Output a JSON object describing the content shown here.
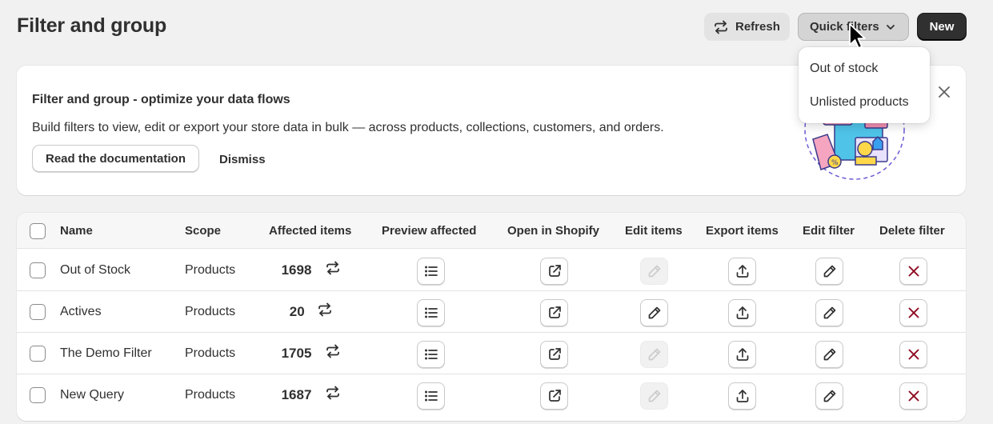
{
  "header": {
    "title": "Filter and group",
    "refresh_label": "Refresh",
    "quick_filters_label": "Quick filters",
    "new_label": "New"
  },
  "quick_filters_menu": {
    "items": [
      "Out of stock",
      "Unlisted products"
    ]
  },
  "banner": {
    "title": "Filter and group - optimize your data flows",
    "description": "Build filters to view, edit or export your store data in bulk — across products, collections, customers, and orders.",
    "doc_button": "Read the documentation",
    "dismiss_button": "Dismiss"
  },
  "table": {
    "columns": {
      "name": "Name",
      "scope": "Scope",
      "affected": "Affected items",
      "preview": "Preview affected",
      "open": "Open in Shopify",
      "edit_items": "Edit items",
      "export": "Export items",
      "edit_filter": "Edit filter",
      "delete": "Delete filter"
    },
    "rows": [
      {
        "name": "Out of Stock",
        "scope": "Products",
        "count": "1698",
        "edit_items_enabled": false
      },
      {
        "name": "Actives",
        "scope": "Products",
        "count": "20",
        "edit_items_enabled": true
      },
      {
        "name": "The Demo Filter",
        "scope": "Products",
        "count": "1705",
        "edit_items_enabled": false
      },
      {
        "name": "New Query",
        "scope": "Products",
        "count": "1687",
        "edit_items_enabled": false
      }
    ]
  },
  "colors": {
    "primary_button": "#303030",
    "delete_icon": "#8e0b21",
    "background": "#f1f1f1"
  },
  "icons": [
    "refresh-icon",
    "chevron-down-icon",
    "close-icon",
    "list-icon",
    "external-link-icon",
    "pencil-icon",
    "upload-icon",
    "delete-x-icon",
    "cursor-icon"
  ]
}
